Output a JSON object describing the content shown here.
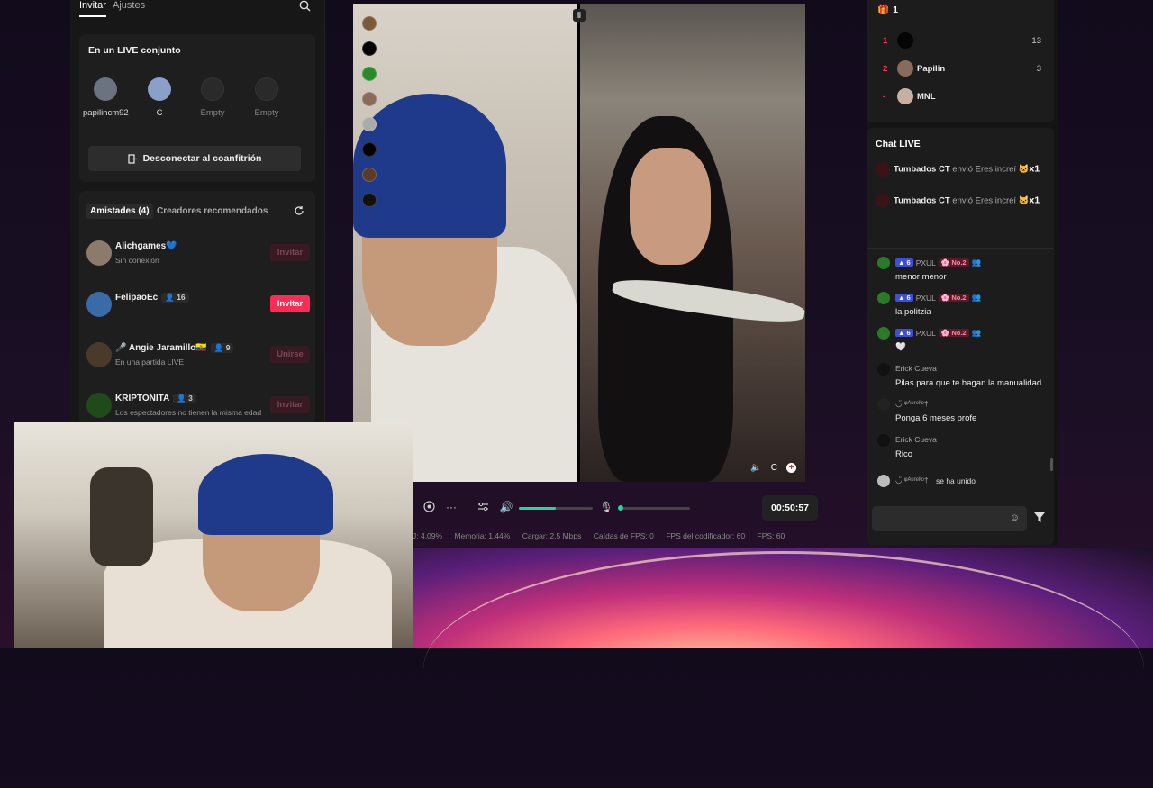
{
  "left_panel": {
    "tabs": [
      "Invitar",
      "Ajustes"
    ],
    "cohost": {
      "title": "En un LIVE conjunto",
      "slots": [
        {
          "label": "papilincm92",
          "empty": false
        },
        {
          "label": "C",
          "empty": false
        },
        {
          "label": "Empty",
          "empty": true
        },
        {
          "label": "Empty",
          "empty": true
        }
      ],
      "disconnect_label": "Desconectar al coanfitrión"
    },
    "friends": {
      "tabs": [
        "Amistades (4)",
        "Creadores recomendados"
      ],
      "items": [
        {
          "name": "Alichgames💙",
          "sub": "Sin conexión",
          "count": "",
          "button": "Invitar",
          "enabled": false
        },
        {
          "name": "FelipaoEc",
          "sub": "",
          "count": "16",
          "button": "Invitar",
          "enabled": true
        },
        {
          "name": "🎤 Angie Jaramillo🇪🇨",
          "sub": "En una partida LIVE",
          "count": "9",
          "button": "Unirse",
          "enabled": false
        },
        {
          "name": "KRIPTONITA",
          "sub": "Los espectadores no tienen la misma edad",
          "count": "3",
          "button": "Invitar",
          "enabled": false
        }
      ]
    }
  },
  "live": {
    "overlay_label": "C",
    "timer": "00:50:57",
    "volume_level": 0.5,
    "stats": [
      "J: 4.09%",
      "Memoria: 1.44%",
      "Cargar: 2.5 Mbps",
      "Caídas de FPS: 0",
      "FPS del codificador: 60",
      "FPS: 60"
    ]
  },
  "right_panel": {
    "ranking": {
      "count": "1",
      "rows": [
        {
          "rank": "1",
          "name": "",
          "score": "13"
        },
        {
          "rank": "2",
          "name": "Papilin",
          "score": "3"
        },
        {
          "rank": "-",
          "name": "MNL",
          "score": ""
        }
      ]
    },
    "chat": {
      "title": "Chat LIVE",
      "gifts": [
        {
          "user": "Tumbados CT",
          "text": "envió Eres increí",
          "mult": "x1"
        },
        {
          "user": "Tumbados CT",
          "text": "envió Eres increí",
          "mult": "x1"
        }
      ],
      "messages": [
        {
          "user": "PXUL",
          "level": "6",
          "rank": "No.2",
          "text": "menor menor",
          "badges": true
        },
        {
          "user": "PXUL",
          "level": "6",
          "rank": "No.2",
          "text": "la politzia",
          "badges": true
        },
        {
          "user": "PXUL",
          "level": "6",
          "rank": "No.2",
          "text": "🤍",
          "badges": true
        },
        {
          "user": "Erick Cueva",
          "level": "",
          "rank": "",
          "text": "Pilas para que te hagan la manualidad",
          "badges": false
        },
        {
          "user": "◡̈ ᵠᴬᵘʳᵉˡⁱᵒ†",
          "level": "",
          "rank": "",
          "text": "Ponga 6 meses profe",
          "badges": false
        },
        {
          "user": "Erick Cueva",
          "level": "",
          "rank": "",
          "text": "Rico",
          "badges": false
        }
      ],
      "join_notice": {
        "user": "◡̈ ᵠᴬᵘʳᵉˡⁱᵒ†",
        "text": "se ha unido"
      }
    }
  }
}
